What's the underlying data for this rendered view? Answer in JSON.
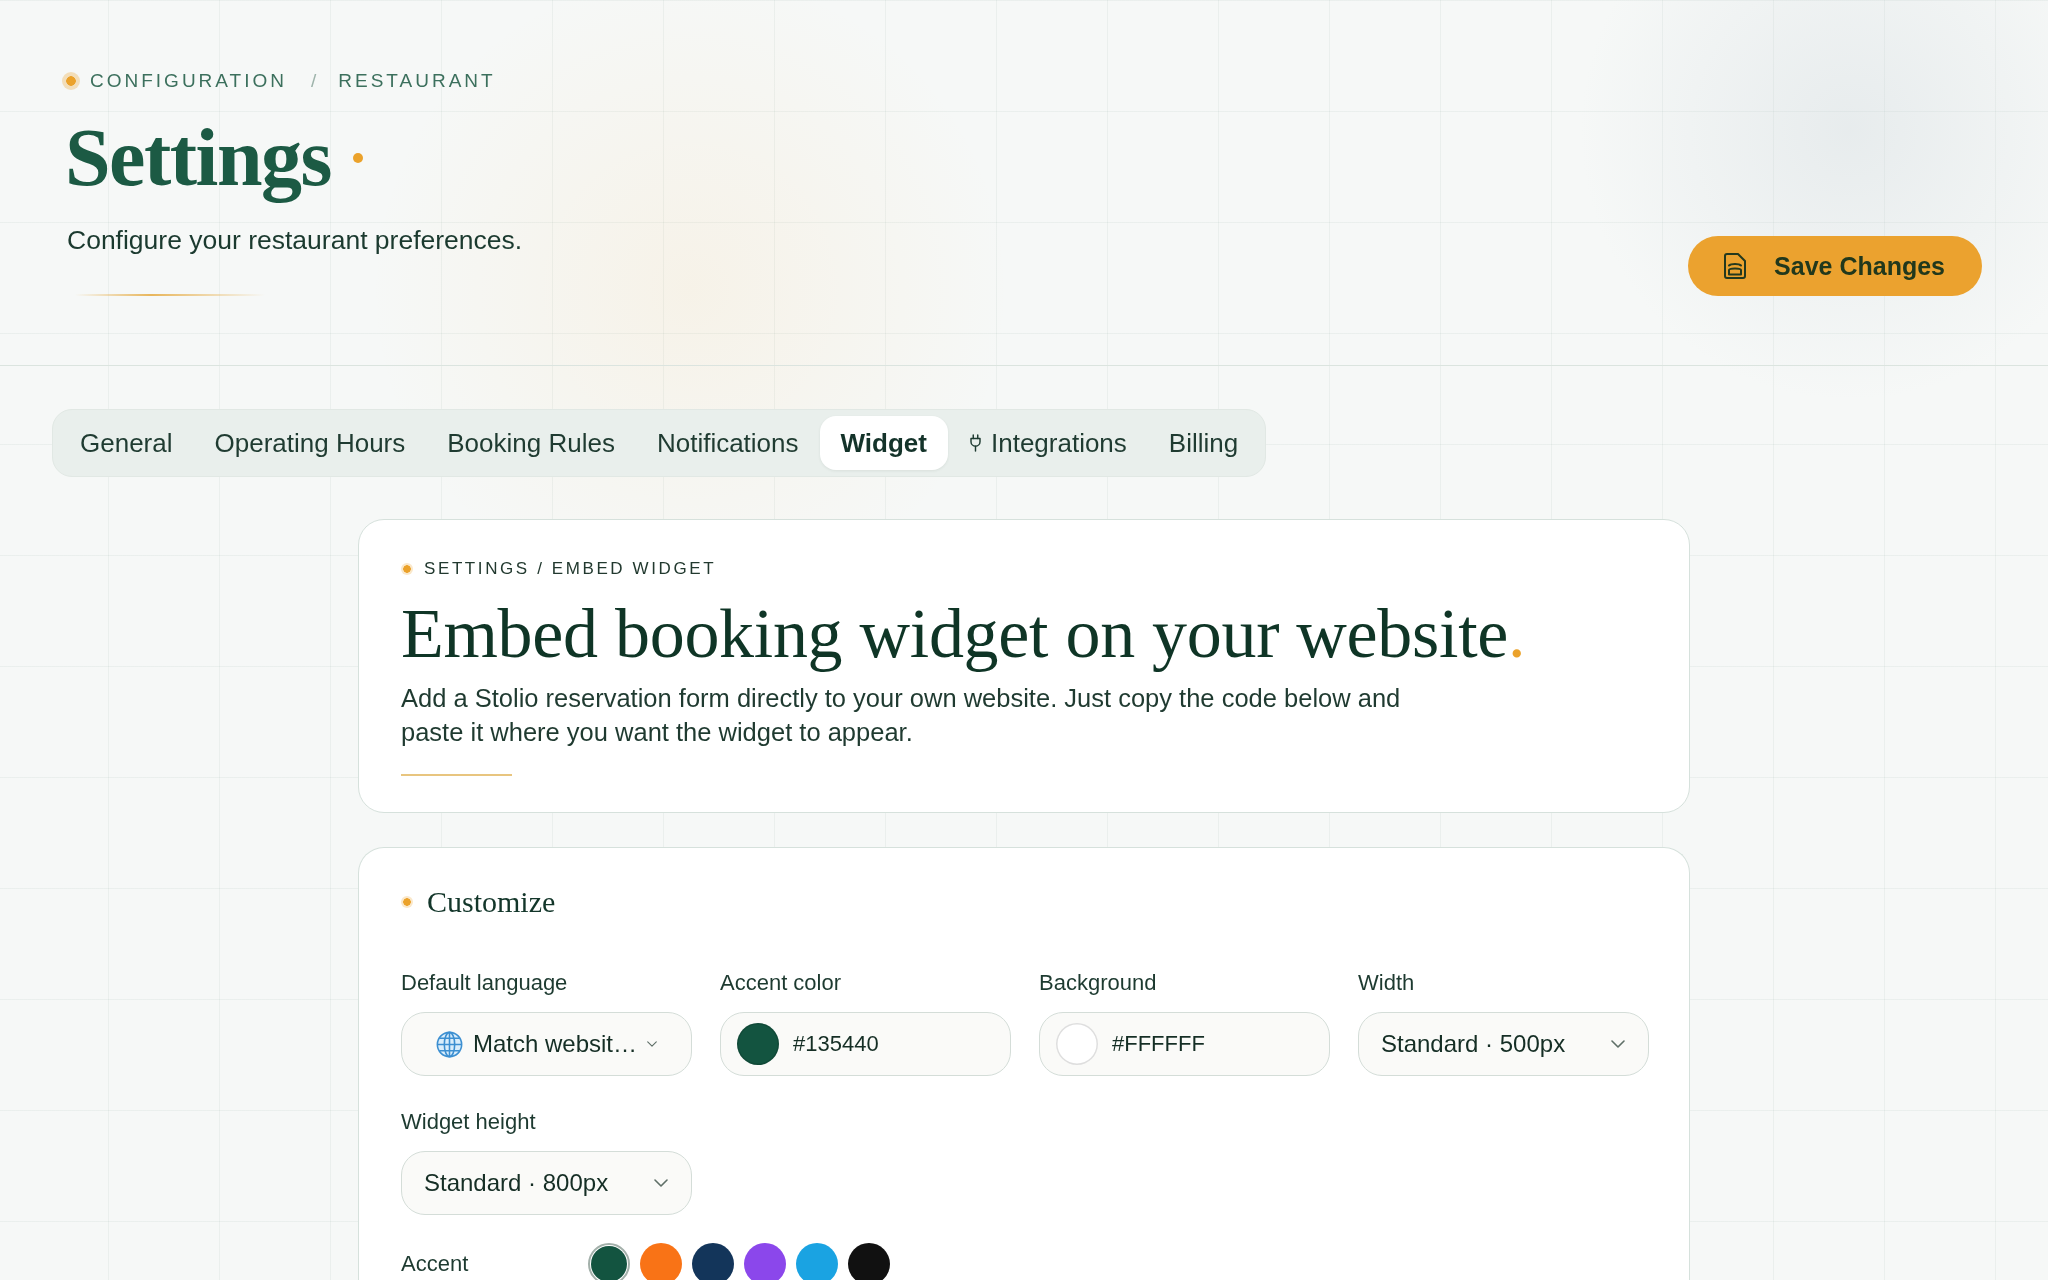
{
  "header": {
    "breadcrumb": {
      "items": [
        "CONFIGURATION",
        "RESTAURANT"
      ],
      "separator": "/"
    },
    "title": "Settings",
    "subtitle": "Configure your restaurant preferences.",
    "save_button": "Save Changes"
  },
  "tabs": [
    {
      "label": "General",
      "kind": "plain",
      "selected": false
    },
    {
      "label": "Operating Hours",
      "kind": "plain",
      "selected": false
    },
    {
      "label": "Booking Rules",
      "kind": "plain",
      "selected": false
    },
    {
      "label": "Notifications",
      "kind": "plain",
      "selected": false
    },
    {
      "label": "Widget",
      "kind": "plain",
      "selected": true
    },
    {
      "label": "Integrations",
      "kind": "icon",
      "selected": false
    },
    {
      "label": "Billing",
      "kind": "plain",
      "selected": false
    }
  ],
  "intro_card": {
    "breadcrumb": "SETTINGS / EMBED WIDGET",
    "title": "Embed booking widget on your website",
    "title_end": ".",
    "description": "Add a Stolio reservation form directly to your own website. Just copy the code below and paste it where you want the widget to appear."
  },
  "customize": {
    "title": "Customize",
    "fields": [
      {
        "kind": "language",
        "label": "Default language",
        "value": "Match websit…"
      },
      {
        "kind": "color",
        "label": "Accent color",
        "value": "#135440",
        "color": "#135440"
      },
      {
        "kind": "color",
        "label": "Background",
        "value": "#FFFFFF",
        "color": "#ffffff"
      },
      {
        "kind": "select",
        "label": "Width",
        "value": "Standard · 500px"
      },
      {
        "kind": "select",
        "label": "Widget height",
        "value": "Standard · 800px"
      }
    ],
    "accent": {
      "label": "Accent",
      "swatches": [
        {
          "color": "#135440",
          "selected": true
        },
        {
          "color": "#f97316",
          "selected": false
        },
        {
          "color": "#13355a",
          "selected": false
        },
        {
          "color": "#8b47eb",
          "selected": false
        },
        {
          "color": "#1aa3e2",
          "selected": false
        },
        {
          "color": "#111111",
          "selected": false
        }
      ]
    }
  }
}
